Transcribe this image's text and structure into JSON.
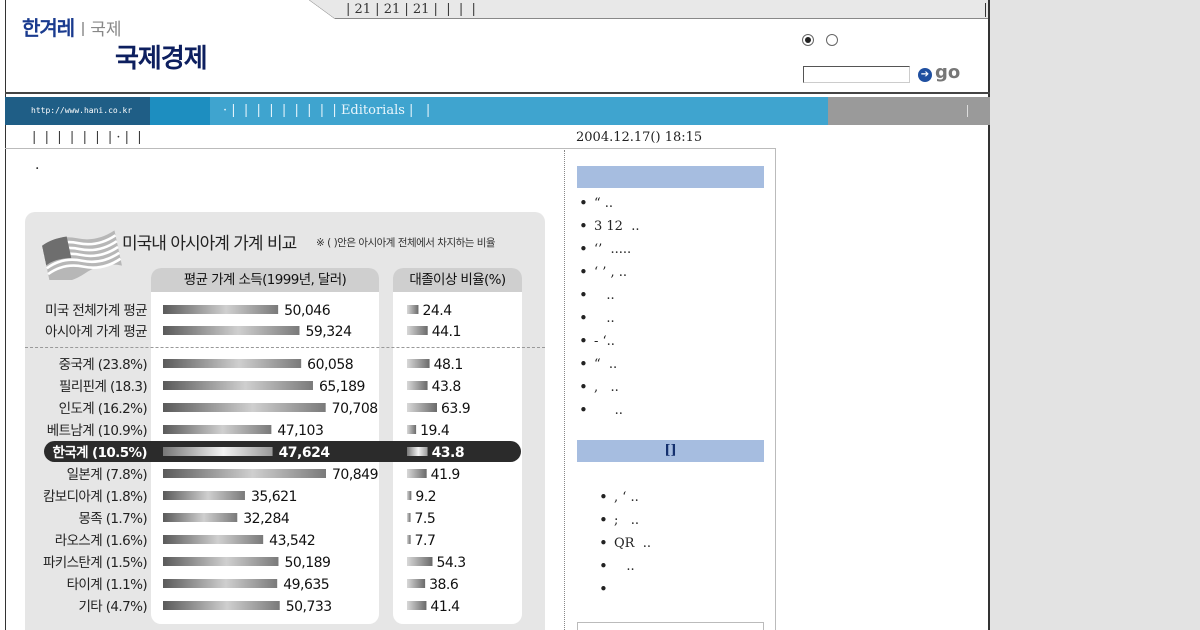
{
  "top_strip": {
    "text": "| 21 | 21 | 21 |  |  |  |"
  },
  "header": {
    "brand": "한겨레",
    "section": "국제",
    "title": "국제경제"
  },
  "search": {
    "placeholder": "",
    "go_label": "go",
    "icon": "arrow-right-circle-icon"
  },
  "nav": {
    "url_label": "http://www.hani.co.kr",
    "items_pre": "· |  |  |  |  |  |  |  |  | ",
    "editorials": "Editorials",
    "items_post": " |   |"
  },
  "subnav": {
    "links": "|  |  |  |  |  |  | · |  |"
  },
  "article": {
    "timestamp": "2004.12.17() 18:15",
    "bullet": "·"
  },
  "chart_data": {
    "type": "bar",
    "title": "미국내 아시아계 가계 비교",
    "note": "※ ( )안은 아시아계 전체에서 차지하는 비율",
    "panel_income_header": "평균 가계 소득(1999년, 달러)",
    "panel_college_header": "대졸이상 비율(%)",
    "highlight_category": "한국계 (10.5%)",
    "categories": [
      "미국 전체가계 평균",
      "아시아계 가계 평균",
      "중국계 (23.8%)",
      "필리핀계 (18.3)",
      "인도계 (16.2%)",
      "베트남계 (10.9%)",
      "한국계 (10.5%)",
      "일본계 (7.8%)",
      "캄보디아계 (1.8%)",
      "몽족 (1.7%)",
      "라오스계 (1.6%)",
      "파키스탄계 (1.5%)",
      "타이계 (1.1%)",
      "기타 (4.7%)"
    ],
    "series": [
      {
        "name": "평균 가계 소득(1999년, 달러)",
        "values": [
          50046,
          59324,
          60058,
          65189,
          70708,
          47103,
          47624,
          70849,
          35621,
          32284,
          43542,
          50189,
          49635,
          50733
        ],
        "labels": [
          "50,046",
          "59,324",
          "60,058",
          "65,189",
          "70,708",
          "47,103",
          "47,624",
          "70,849",
          "35,621",
          "32,284",
          "43,542",
          "50,189",
          "49,635",
          "50,733"
        ]
      },
      {
        "name": "대졸이상 비율(%)",
        "values": [
          24.4,
          44.1,
          48.1,
          43.8,
          63.9,
          19.4,
          43.8,
          41.9,
          9.2,
          7.5,
          7.7,
          54.3,
          38.6,
          41.4
        ],
        "labels": [
          "24.4",
          "44.1",
          "48.1",
          "43.8",
          "63.9",
          "19.4",
          "43.8",
          "41.9",
          "9.2",
          "7.5",
          "7.7",
          "54.3",
          "38.6",
          "41.4"
        ]
      }
    ]
  },
  "sidebar": {
    "section1_header": "",
    "section1_items": [
      "“ ..",
      "3 12  ..",
      "‘’  .....",
      "‘ ’ , ..",
      "   ..",
      "   ..",
      "- ‘..",
      "“  ..",
      ",   ..",
      "     .."
    ],
    "section2_header": "[]",
    "section2_items": [
      ", ‘ ..",
      ";   ..",
      "QR  ..",
      "   ..",
      ""
    ]
  },
  "colors": {
    "nav_blue": "#3fa4cf",
    "nav_dark": "#1f5e86",
    "sidebar_header": "#a6bde0",
    "brand": "#1a3b8f"
  }
}
